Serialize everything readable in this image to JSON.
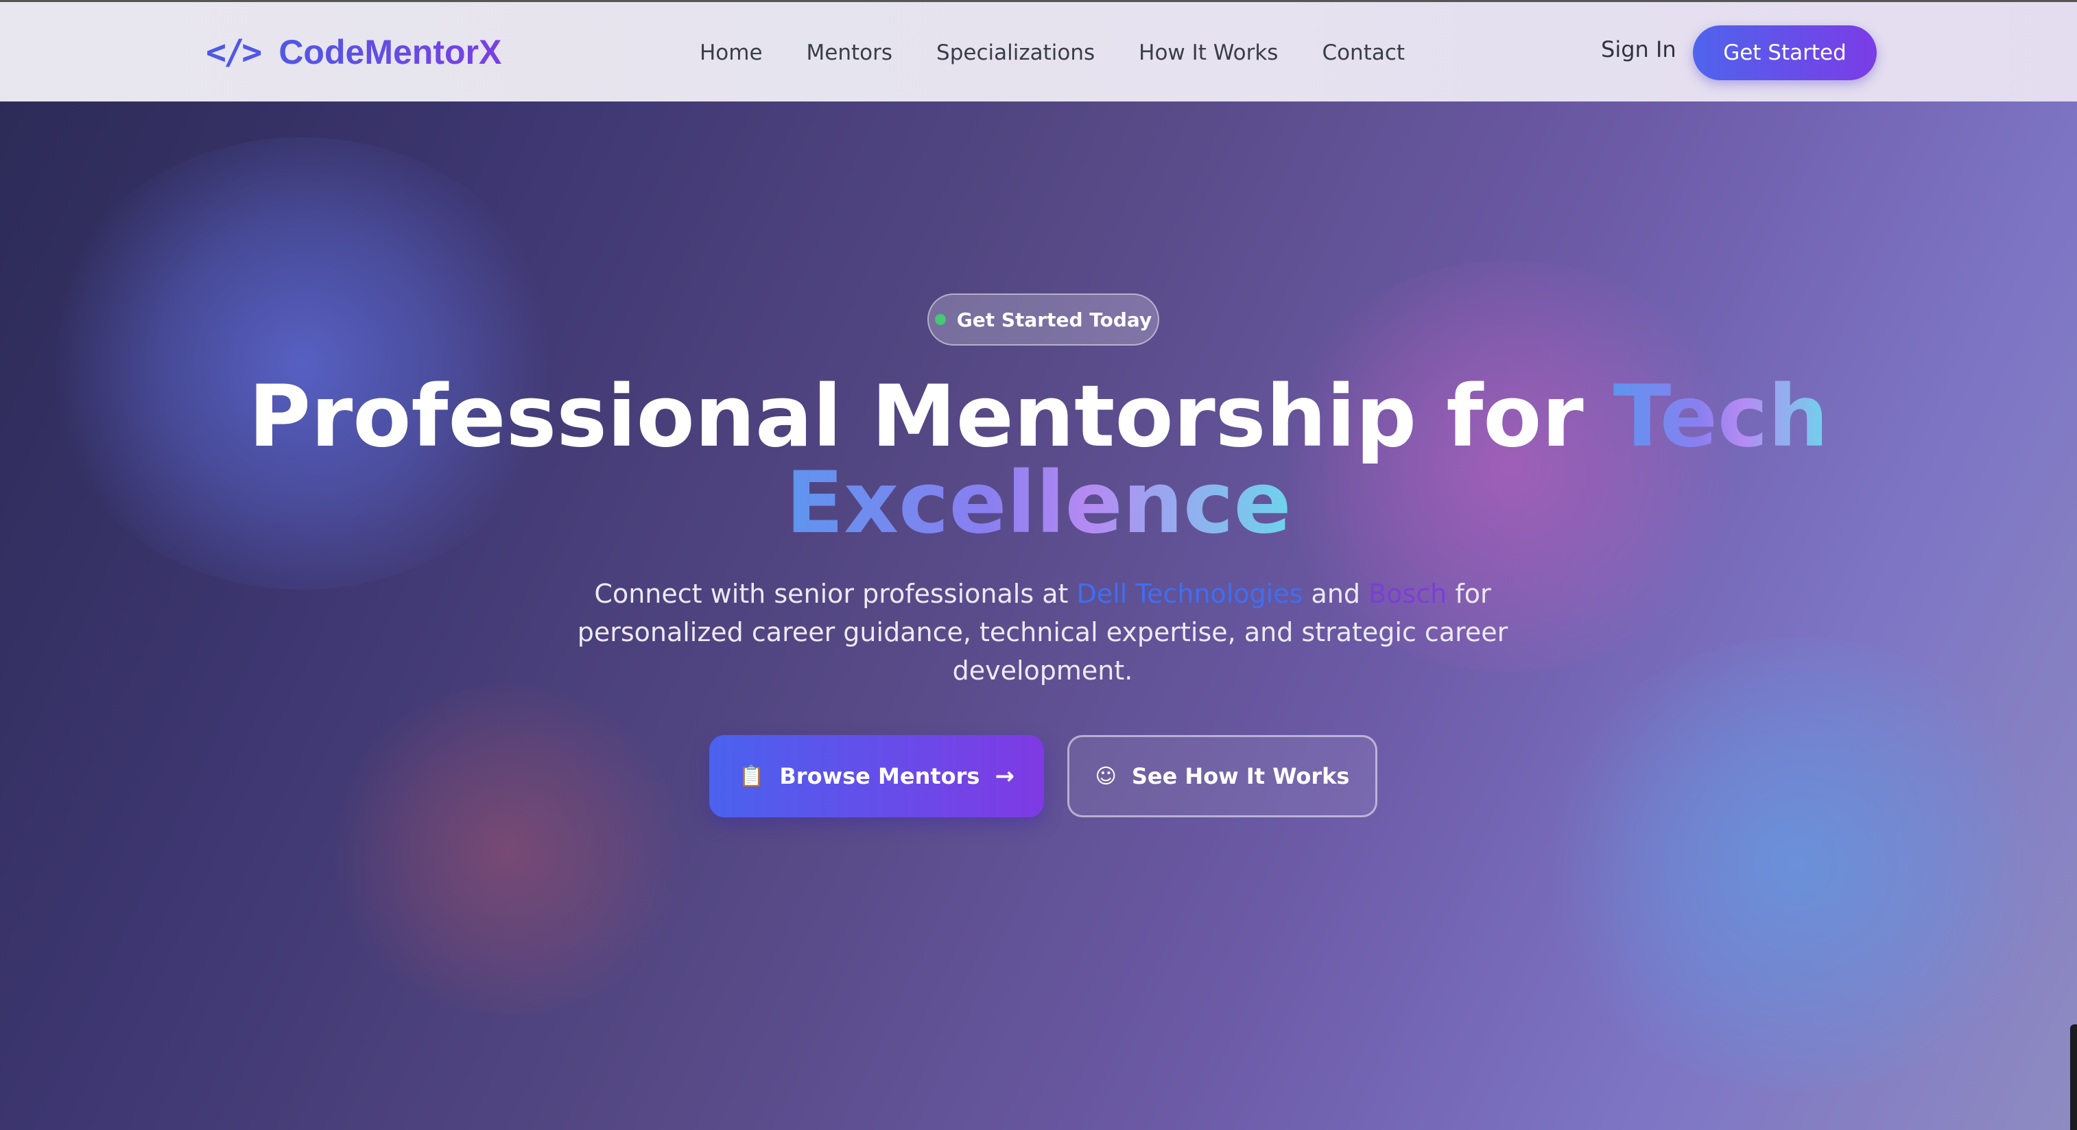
{
  "brand": {
    "icon": "code-brackets-icon",
    "icon_glyph": "</>",
    "name": "CodeMentorX"
  },
  "nav": {
    "links": [
      "Home",
      "Mentors",
      "Specializations",
      "How It Works",
      "Contact"
    ],
    "sign_in": "Sign In",
    "cta": "Get Started"
  },
  "hero": {
    "badge": "Get Started Today",
    "headline_prefix": "Professional Mentorship for",
    "headline_highlight_1": "Tech",
    "headline_highlight_2": "Excellence",
    "sub_part_1": "Connect with senior professionals at",
    "company_1": "Dell Technologies",
    "sub_part_2": "and",
    "company_2": "Bosch",
    "sub_part_3": "for personalized career guidance, technical expertise, and strategic career development.",
    "primary_button": "Browse Mentors",
    "primary_icon": "clipboard-icon",
    "primary_icon_glyph": "📋",
    "primary_arrow": "→",
    "secondary_button": "See How It Works",
    "secondary_icon": "smiley-icon",
    "secondary_icon_glyph": "☺"
  },
  "colors": {
    "brand": "#5b4de0",
    "accent_start": "#4f64ec",
    "accent_end": "#7b3ce6",
    "badge_dot": "#48c774",
    "dell_highlight": "#3f6ef0",
    "bosch_highlight": "#7a3ed8"
  }
}
